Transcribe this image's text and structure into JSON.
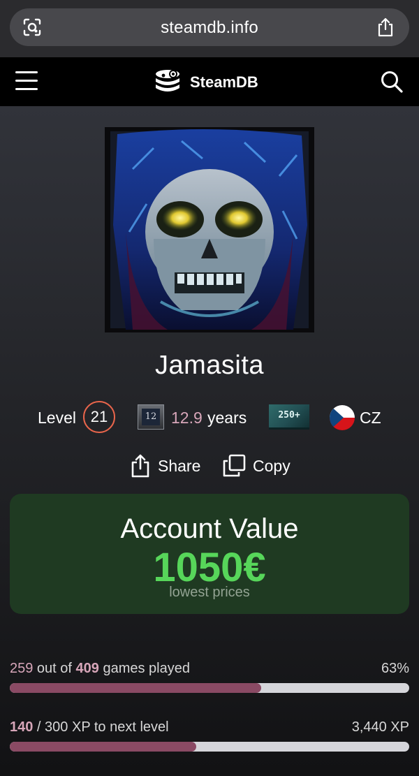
{
  "browser": {
    "url": "steamdb.info",
    "lens_icon": "camera-lens-icon",
    "share_icon": "share-icon"
  },
  "header": {
    "brand": "SteamDB",
    "menu_icon": "hamburger-menu-icon",
    "search_icon": "search-icon"
  },
  "profile": {
    "username": "Jamasita",
    "level_label": "Level",
    "level": "21",
    "years_badge": "12",
    "years_value": "12.9",
    "years_unit": "years",
    "games_badge": "250+",
    "country": "CZ"
  },
  "actions": {
    "share_label": "Share",
    "copy_label": "Copy"
  },
  "account_value": {
    "title": "Account Value",
    "amount": "1050€",
    "subtitle": "lowest prices"
  },
  "games_progress": {
    "played": "259",
    "out_of_text": " out of ",
    "total": "409",
    "suffix": " games played",
    "percent_text": "63%",
    "fraction": 0.63
  },
  "xp_progress": {
    "current": "140",
    "separator": " / ",
    "suffix": "300 XP to next level",
    "total_xp": "3,440 XP",
    "fraction": 0.4667
  },
  "colors": {
    "accent_pink": "#d7a6b9",
    "bar_fill": "#8a4a64",
    "value_green": "#57d65a",
    "level_ring": "#e8654b"
  }
}
